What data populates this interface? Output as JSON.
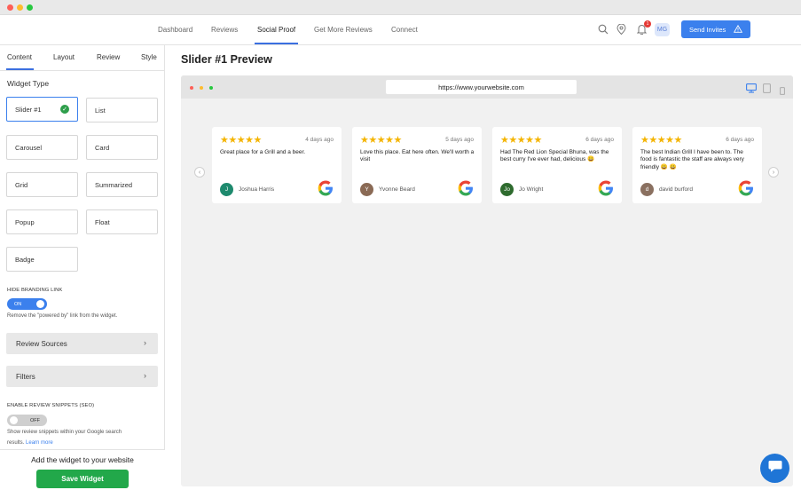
{
  "nav": {
    "items": [
      "Dashboard",
      "Reviews",
      "Social Proof",
      "Get More Reviews",
      "Connect"
    ],
    "notification_count": "1",
    "avatar_initials": "MG",
    "send_invites": "Send Invites"
  },
  "sidebar": {
    "tabs": [
      "Content",
      "Layout",
      "Review",
      "Style"
    ],
    "widget_type_title": "Widget Type",
    "widget_types": [
      "Slider #1",
      "List",
      "Carousel",
      "Card",
      "Grid",
      "Summarized",
      "Popup",
      "Float",
      "Badge"
    ],
    "selected_widget": "Slider #1",
    "hide_branding": {
      "title": "HIDE BRANDING LINK",
      "toggle": "ON",
      "description": "Remove the \"powered by\" link from the widget."
    },
    "review_sources": "Review Sources",
    "filters": "Filters",
    "snippets": {
      "title": "ENABLE REVIEW SNIPPETS (SEO)",
      "toggle": "OFF",
      "description_line1": "Show review snippets within your Google search",
      "description_line2": "results.",
      "learn_more": "Learn more"
    },
    "footer_text": "Add the widget to your website",
    "save_button": "Save Widget"
  },
  "main": {
    "title": "Slider #1 Preview",
    "url": "https://www.yourwebsite.com",
    "reviews": [
      {
        "stars": "★★★★★",
        "date": "4 days ago",
        "text": "Great place for a Grill and a beer.",
        "initial": "J",
        "avatar_color": "#1e8a6e",
        "name": "Joshua Harris"
      },
      {
        "stars": "★★★★★",
        "date": "5 days ago",
        "text": "Love this place. Eat here often. We'll worth a visit",
        "initial": "Y",
        "avatar_color": "#8a6a55",
        "name": "Yvonne Beard"
      },
      {
        "stars": "★★★★★",
        "date": "6 days ago",
        "text": "Had The Red Lion Special Bhuna, was the best curry I've ever had, delicious 😀",
        "initial": "Jo",
        "avatar_color": "#2e6b2e",
        "name": "Jo Wright"
      },
      {
        "stars": "★★★★★",
        "date": "6 days ago",
        "text": "The best Indian Grill I have been to. The food is fantastic the staff are always very friendly 😀 😀",
        "initial": "d",
        "avatar_color": "#8a7060",
        "name": "david burford"
      }
    ]
  },
  "colors": {
    "primary": "#3b80ed",
    "save": "#22a84a",
    "star": "#f4b400"
  }
}
